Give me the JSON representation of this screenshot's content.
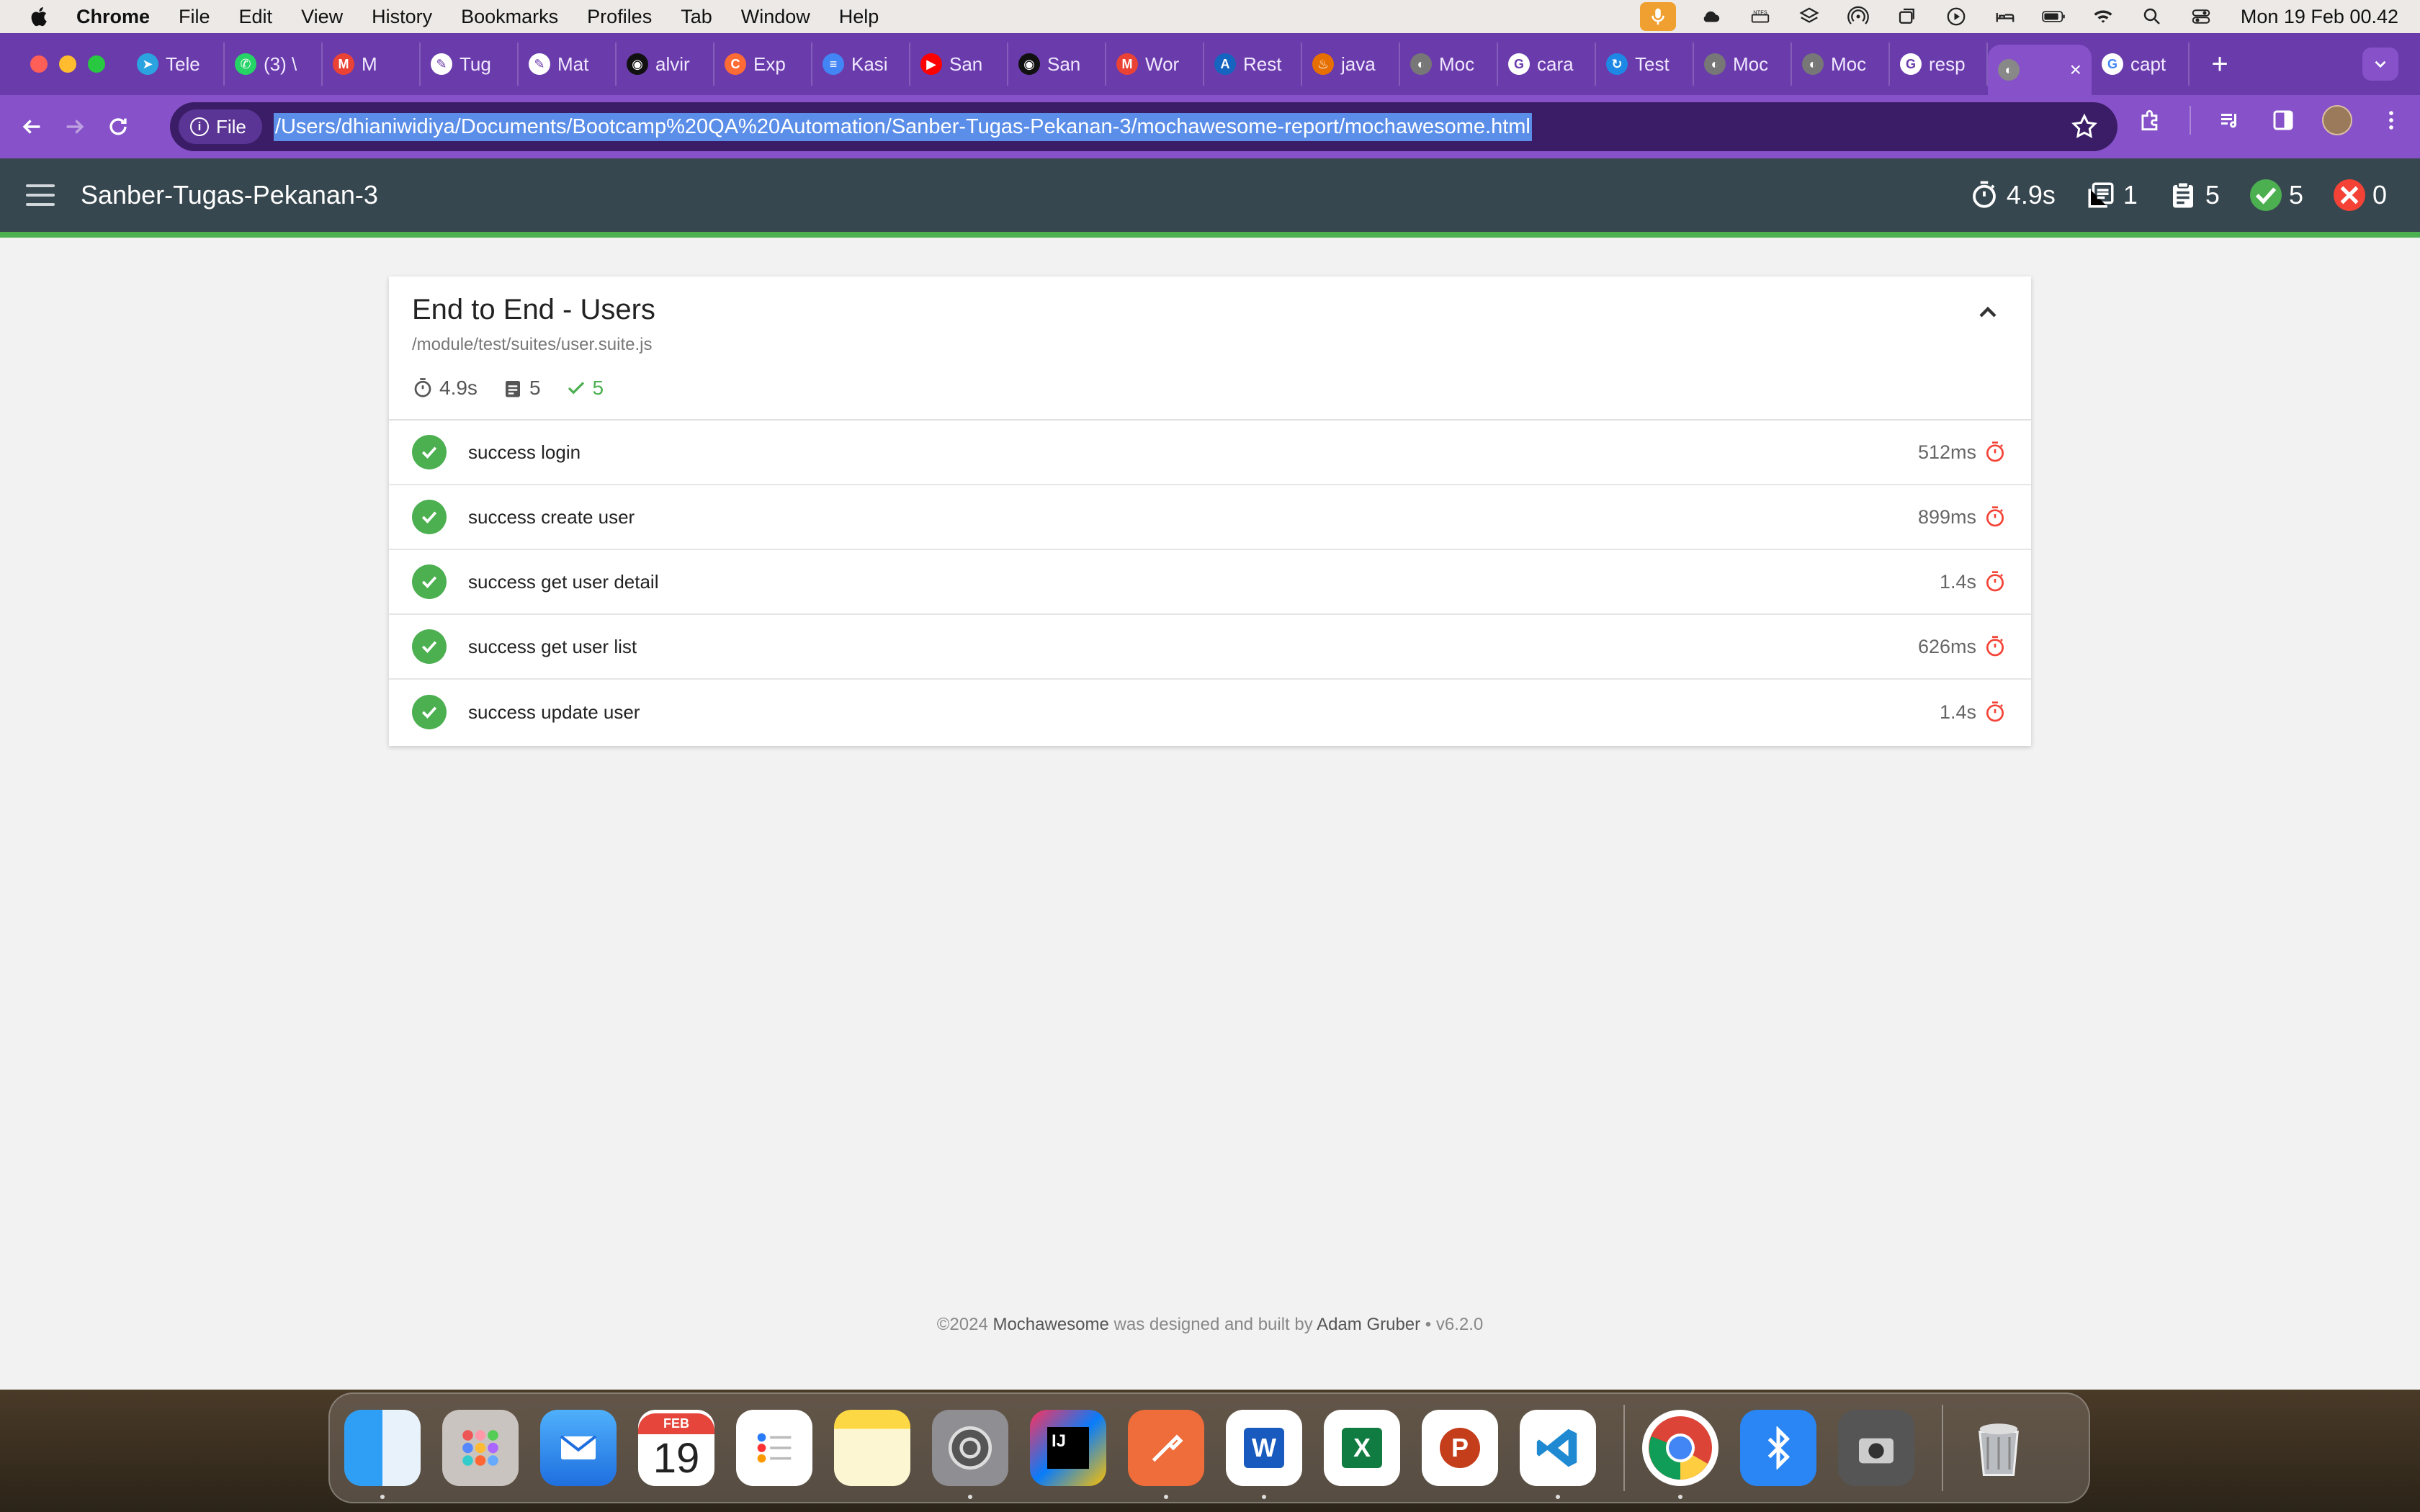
{
  "menubar": {
    "app_name": "Chrome",
    "menus": [
      "File",
      "Edit",
      "View",
      "History",
      "Bookmarks",
      "Profiles",
      "Tab",
      "Window",
      "Help"
    ],
    "clock": "Mon 19 Feb  00.42"
  },
  "tabs": [
    {
      "label": "Tele",
      "color": "#2aa3e0",
      "glyph": "➤"
    },
    {
      "label": "(3) \\",
      "color": "#25d366",
      "glyph": "✆"
    },
    {
      "label": "M",
      "color": "#ea4335",
      "glyph": "M"
    },
    {
      "label": "Tug",
      "color": "#ffffff",
      "glyph": "✎"
    },
    {
      "label": "Mat",
      "color": "#ffffff",
      "glyph": "✎"
    },
    {
      "label": "alvir",
      "color": "#111111",
      "glyph": "◉"
    },
    {
      "label": "Exp",
      "color": "#ff6b35",
      "glyph": "C"
    },
    {
      "label": "Kasi",
      "color": "#4285f4",
      "glyph": "≡"
    },
    {
      "label": "San",
      "color": "#ff0000",
      "glyph": "▶"
    },
    {
      "label": "San",
      "color": "#111111",
      "glyph": "◉"
    },
    {
      "label": "Wor",
      "color": "#ea4335",
      "glyph": "M"
    },
    {
      "label": "Rest",
      "color": "#1565c0",
      "glyph": "A"
    },
    {
      "label": "java",
      "color": "#e76f00",
      "glyph": "♨"
    },
    {
      "label": "Moc",
      "color": "#777777",
      "glyph": "◐"
    },
    {
      "label": "cara",
      "color": "#ffffff",
      "glyph": "G"
    },
    {
      "label": "Test",
      "color": "#1e88e5",
      "glyph": "↻"
    },
    {
      "label": "Moc",
      "color": "#777777",
      "glyph": "◐"
    },
    {
      "label": "Moc",
      "color": "#777777",
      "glyph": "◐"
    },
    {
      "label": "resp",
      "color": "#ffffff",
      "glyph": "G"
    }
  ],
  "active_tab": {
    "label": "",
    "glyph": "◐"
  },
  "last_tab": {
    "label": "capt",
    "glyph": "G"
  },
  "toolbar": {
    "file_chip": "File",
    "url": "/Users/dhianiwidiya/Documents/Bootcamp%20QA%20Automation/Sanber-Tugas-Pekanan-3/mochawesome-report/mochawesome.html"
  },
  "report": {
    "title": "Sanber-Tugas-Pekanan-3",
    "stats": {
      "duration": "4.9s",
      "suites": "1",
      "tests": "5",
      "passed": "5",
      "failed": "0"
    },
    "suite": {
      "title": "End to End - Users",
      "file": "/module/test/suites/user.suite.js",
      "duration": "4.9s",
      "tests": "5",
      "passed": "5",
      "tests_list": [
        {
          "name": "success login",
          "duration": "512ms"
        },
        {
          "name": "success create user",
          "duration": "899ms"
        },
        {
          "name": "success get user detail",
          "duration": "1.4s"
        },
        {
          "name": "success get user list",
          "duration": "626ms"
        },
        {
          "name": "success update user",
          "duration": "1.4s"
        }
      ]
    },
    "footer": {
      "prefix": "©2024 ",
      "brand": "Mochawesome",
      "middle": " was designed and built by ",
      "author": "Adam Gruber",
      "version": " • v6.2.0"
    }
  },
  "dock": {
    "calendar_month": "FEB",
    "calendar_day": "19",
    "apps": [
      "Finder",
      "Launchpad",
      "Mail",
      "Calendar",
      "Reminders",
      "Notes",
      "System Settings",
      "IntelliJ IDEA",
      "Postman",
      "Word",
      "Excel",
      "PowerPoint",
      "VS Code",
      "Chrome",
      "Bluetooth",
      "Screenshot",
      "Trash"
    ]
  },
  "colors": {
    "tab_strip": "#6a3bab",
    "toolbar": "#8752c9",
    "report_nav": "#37474f",
    "pass": "#4caf50",
    "fail": "#f44336"
  }
}
